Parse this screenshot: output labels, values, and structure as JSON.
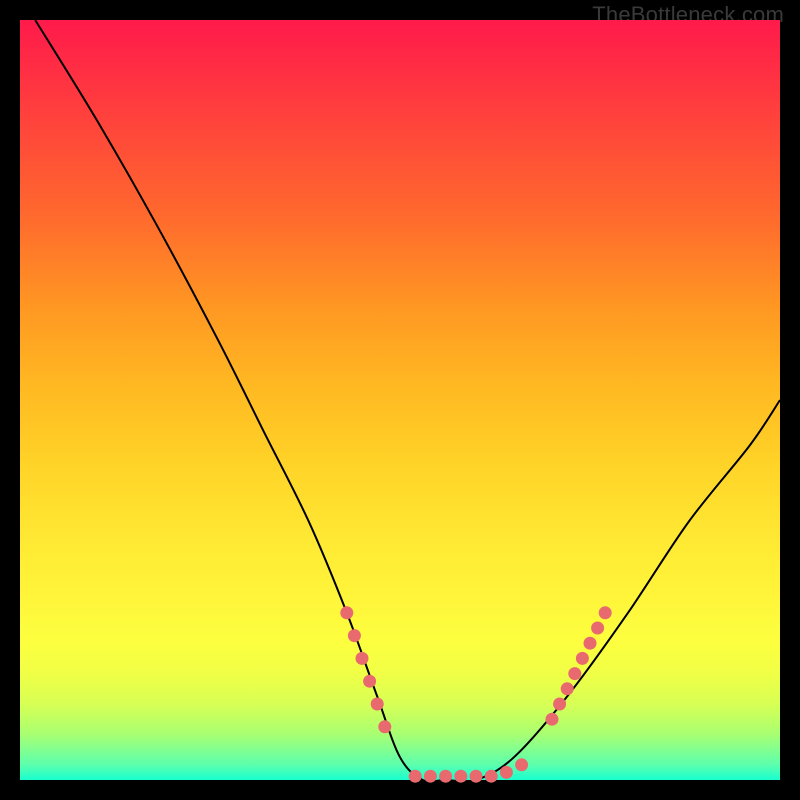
{
  "watermark": "TheBottleneck.com",
  "colors": {
    "frame": "#000000",
    "curve_stroke": "#000000",
    "marker_fill": "#e96a6e",
    "marker_stroke": "#d85a5e"
  },
  "chart_data": {
    "type": "line",
    "title": "",
    "xlabel": "",
    "ylabel": "",
    "xlim": [
      0,
      100
    ],
    "ylim": [
      0,
      100
    ],
    "grid": false,
    "series": [
      {
        "name": "curve",
        "x": [
          2,
          10,
          18,
          26,
          32,
          38,
          43,
          47,
          50,
          53,
          56,
          60,
          65,
          72,
          80,
          88,
          96,
          100
        ],
        "y": [
          100,
          87,
          73,
          58,
          46,
          34,
          22,
          11,
          3,
          0,
          0,
          0,
          3,
          11,
          22,
          34,
          44,
          50
        ]
      }
    ],
    "markers": {
      "description": "salmon dotted segments along the curve flanks and base",
      "groups": [
        {
          "side": "left-flank",
          "points": [
            [
              43,
              22
            ],
            [
              44,
              19
            ],
            [
              45,
              16
            ],
            [
              46,
              13
            ],
            [
              47,
              10
            ],
            [
              48,
              7
            ]
          ]
        },
        {
          "side": "base",
          "points": [
            [
              52,
              0.5
            ],
            [
              54,
              0.5
            ],
            [
              56,
              0.5
            ],
            [
              58,
              0.5
            ],
            [
              60,
              0.5
            ],
            [
              62,
              0.5
            ],
            [
              64,
              1
            ],
            [
              66,
              2
            ]
          ]
        },
        {
          "side": "right-flank",
          "points": [
            [
              70,
              8
            ],
            [
              71,
              10
            ],
            [
              72,
              12
            ],
            [
              73,
              14
            ],
            [
              74,
              16
            ],
            [
              75,
              18
            ],
            [
              76,
              20
            ],
            [
              77,
              22
            ]
          ]
        }
      ]
    }
  }
}
